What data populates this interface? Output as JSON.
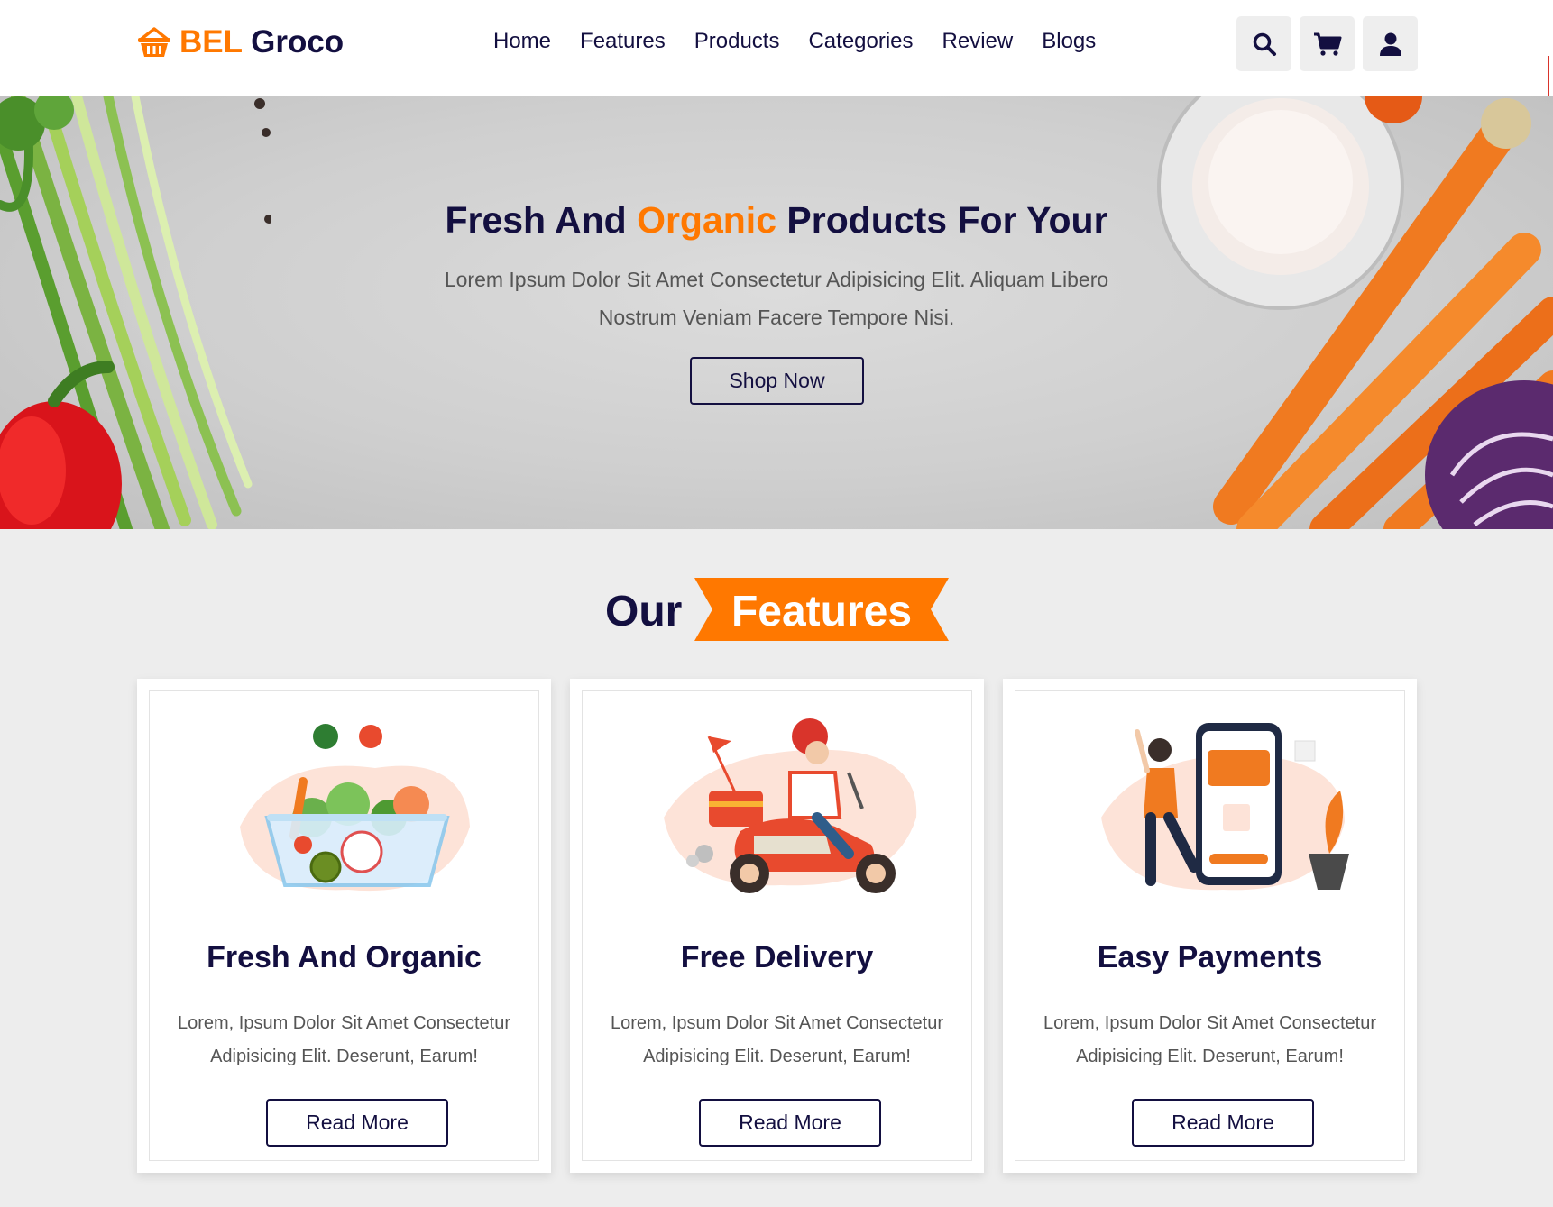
{
  "brand": {
    "part1": "BEL",
    "part2": "Groco",
    "icon": "basket-icon"
  },
  "nav": {
    "items": [
      {
        "label": "Home"
      },
      {
        "label": "Features"
      },
      {
        "label": "Products"
      },
      {
        "label": "Categories"
      },
      {
        "label": "Review"
      },
      {
        "label": "Blogs"
      }
    ]
  },
  "header_icons": [
    "search-icon",
    "cart-icon",
    "user-icon"
  ],
  "hero": {
    "title_before": "Fresh And ",
    "title_accent": "Organic",
    "title_after": " Products For Your",
    "description": "Lorem Ipsum Dolor Sit Amet Consectetur Adipisicing Elit. Aliquam Libero Nostrum Veniam Facere Tempore Nisi.",
    "button": "Shop Now"
  },
  "features": {
    "heading_plain": "Our",
    "heading_accent": "Features",
    "cards": [
      {
        "title": "Fresh And Organic",
        "description": "Lorem, Ipsum Dolor Sit Amet Consectetur Adipisicing Elit. Deserunt, Earum!",
        "button": "Read More"
      },
      {
        "title": "Free Delivery",
        "description": "Lorem, Ipsum Dolor Sit Amet Consectetur Adipisicing Elit. Deserunt, Earum!",
        "button": "Read More"
      },
      {
        "title": "Easy Payments",
        "description": "Lorem, Ipsum Dolor Sit Amet Consectetur Adipisicing Elit. Deserunt, Earum!",
        "button": "Read More"
      }
    ]
  },
  "colors": {
    "accent": "#ff7800",
    "primary": "#130f40",
    "text_muted": "#555555",
    "background": "#ededed"
  }
}
